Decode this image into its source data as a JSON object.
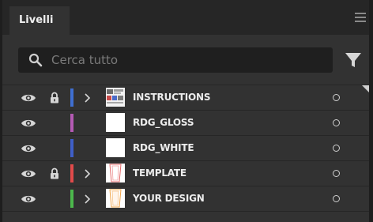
{
  "panel": {
    "tab_label": "Livelli",
    "menu_icon": "hamburger-menu-icon"
  },
  "search": {
    "value": "",
    "placeholder": "Cerca tutto",
    "icon": "search-icon",
    "filter_icon": "filter-icon"
  },
  "layers": [
    {
      "name": "INSTRUCTIONS",
      "visible": true,
      "locked": true,
      "color": "#3f6fd1",
      "expandable": true,
      "thumb": "instructions",
      "selected": true
    },
    {
      "name": "RDG_GLOSS",
      "visible": true,
      "locked": false,
      "color": "#b45ab4",
      "expandable": false,
      "thumb": "blank"
    },
    {
      "name": "RDG_WHITE",
      "visible": true,
      "locked": false,
      "color": "#3f5fc8",
      "expandable": false,
      "thumb": "blank"
    },
    {
      "name": "TEMPLATE",
      "visible": true,
      "locked": true,
      "color": "#e04a4a",
      "expandable": true,
      "thumb": "template"
    },
    {
      "name": "YOUR DESIGN",
      "visible": true,
      "locked": false,
      "color": "#4cb84c",
      "expandable": true,
      "thumb": "design"
    }
  ]
}
